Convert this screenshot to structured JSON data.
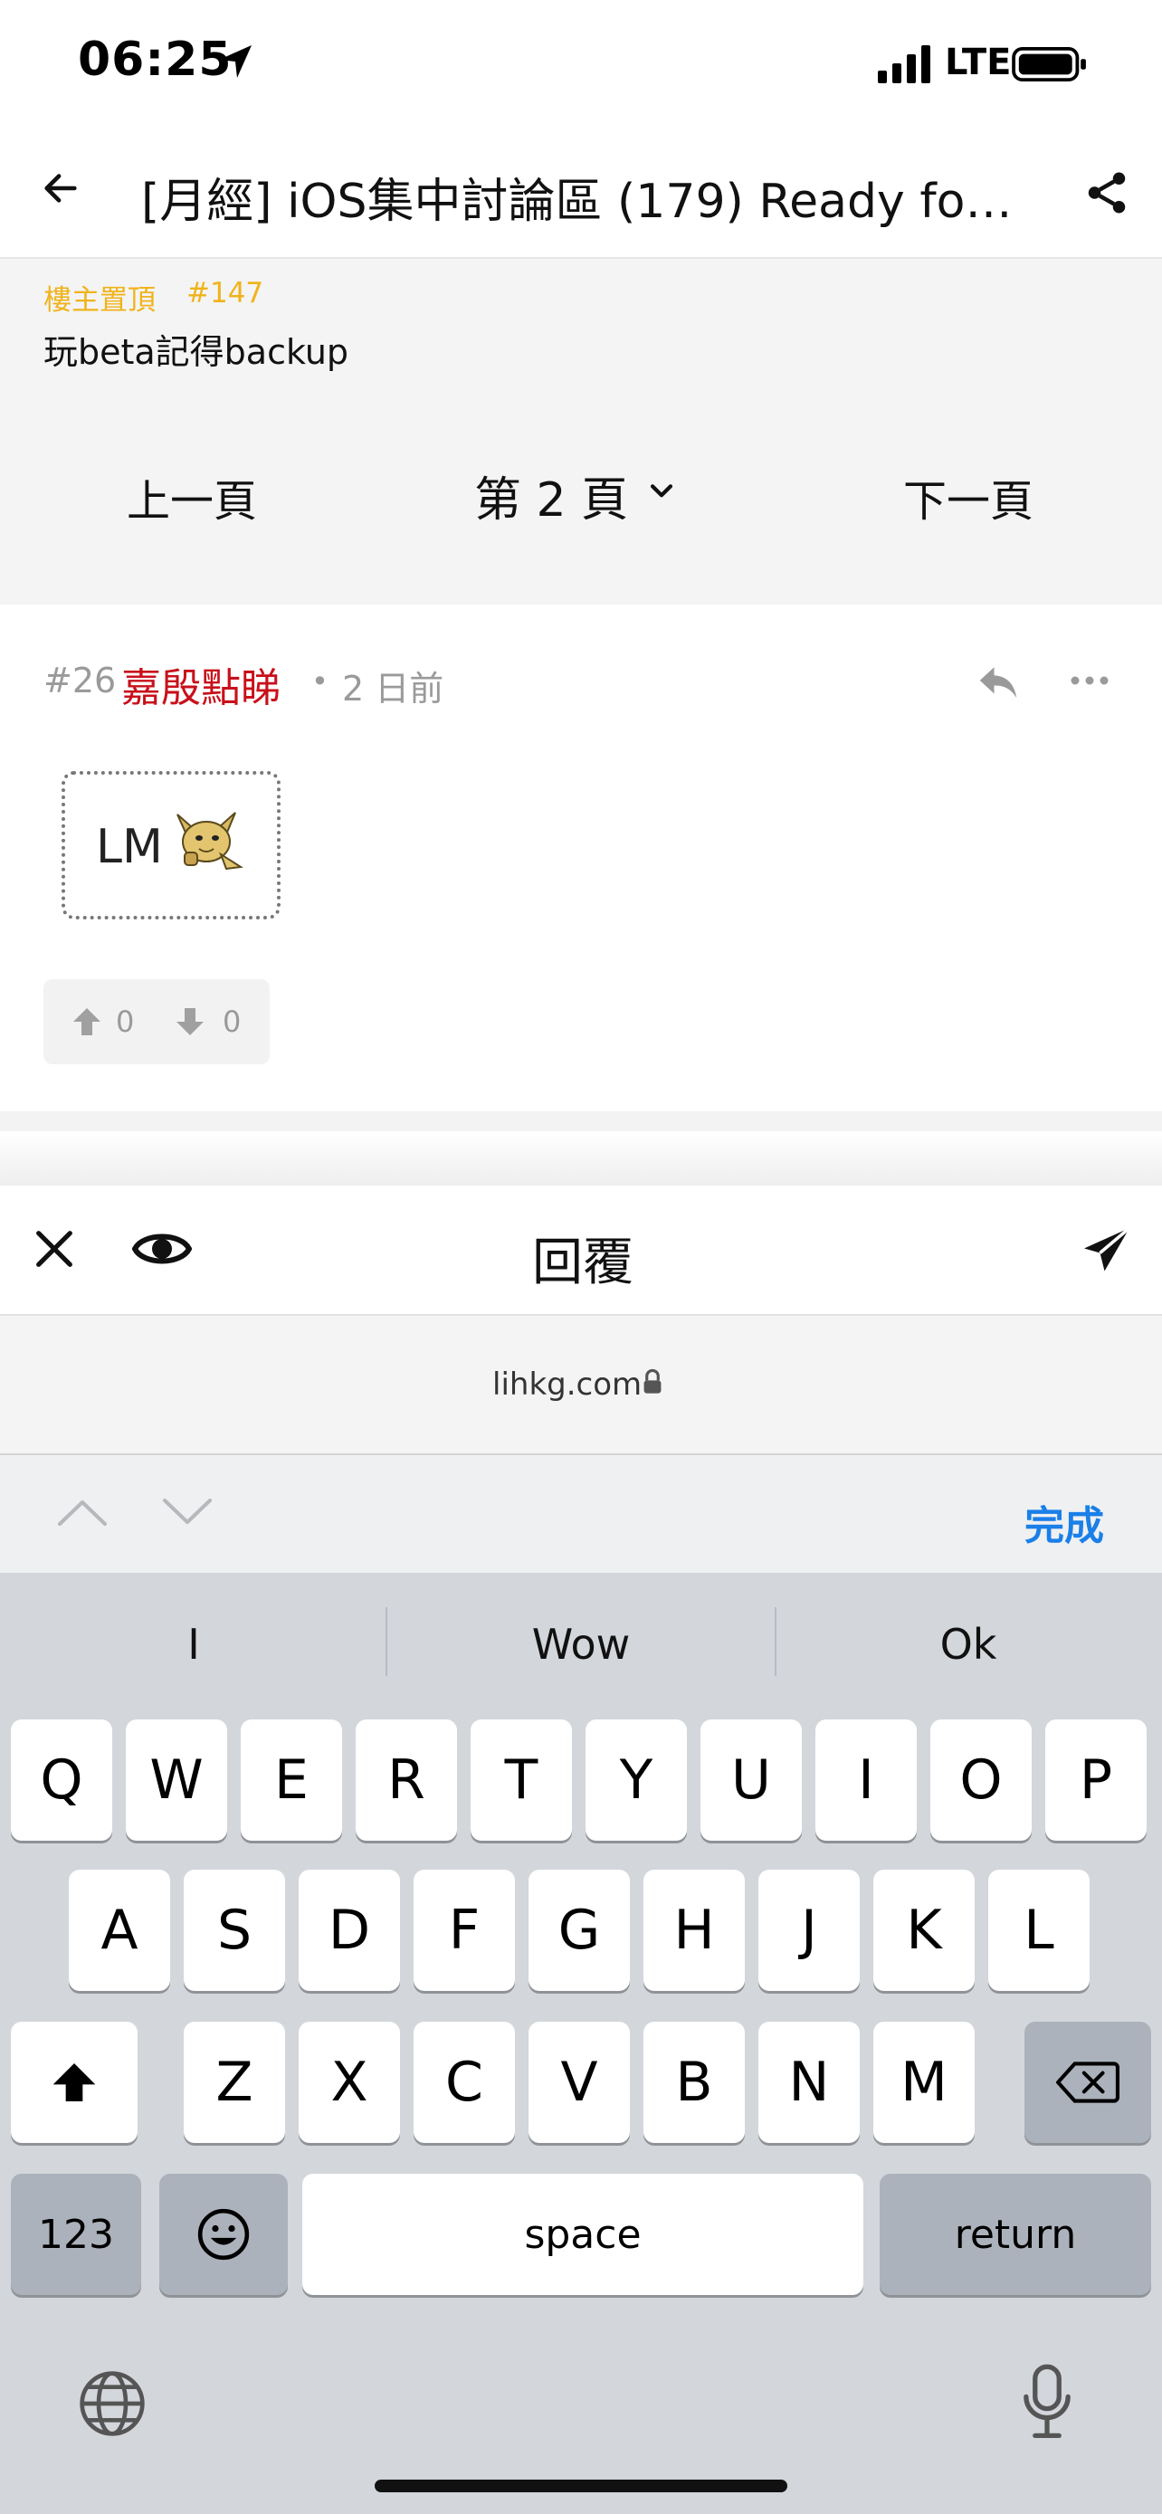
{
  "status": {
    "time": "06:25",
    "network": "LTE"
  },
  "nav": {
    "title": "[月經] iOS集中討論區 (179) Ready for …"
  },
  "pinned": {
    "label": "樓主置頂",
    "number": "#147",
    "text": "玩beta記得backup"
  },
  "pagination": {
    "prev": "上一頁",
    "current": "第 2 頁",
    "next": "下一頁"
  },
  "post": {
    "number": "#26",
    "user": "嘉殷點睇",
    "dot": "•",
    "time": "2 日前",
    "content": "LM",
    "upvotes": "0",
    "downvotes": "0"
  },
  "reply_bar": {
    "title": "回覆"
  },
  "browser": {
    "url": "lihkg.com"
  },
  "accessory": {
    "done": "完成"
  },
  "keyboard": {
    "suggestions": [
      "I",
      "Wow",
      "Ok"
    ],
    "row1": [
      "Q",
      "W",
      "E",
      "R",
      "T",
      "Y",
      "U",
      "I",
      "O",
      "P"
    ],
    "row2": [
      "A",
      "S",
      "D",
      "F",
      "G",
      "H",
      "J",
      "K",
      "L"
    ],
    "row3": [
      "Z",
      "X",
      "C",
      "V",
      "B",
      "N",
      "M"
    ],
    "numbers": "123",
    "space": "space",
    "return": "return"
  },
  "colors": {
    "accent": "#1a7fe8",
    "username": "#c8101a",
    "pinned": "#f0b31b"
  },
  "icons": [
    "location-arrow-icon",
    "signal-icon",
    "battery-icon",
    "back-arrow-icon",
    "share-icon",
    "chevron-down-icon",
    "reply-icon",
    "more-icon",
    "upvote-icon",
    "downvote-icon",
    "close-icon",
    "eye-icon",
    "send-icon",
    "lock-icon",
    "shift-icon",
    "delete-icon",
    "emoji-icon",
    "globe-icon",
    "mic-icon"
  ]
}
